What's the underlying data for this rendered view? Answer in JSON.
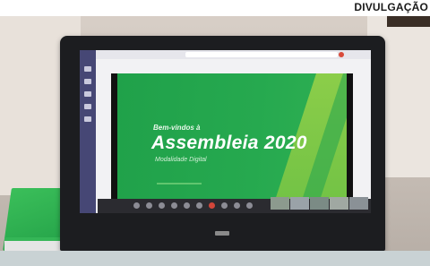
{
  "credit": "DIVULGAÇÃO",
  "slide": {
    "welcome": "Bem-vindos à",
    "headline": "Assembleia 2020",
    "subtitle": "Modalidade Digital"
  },
  "colors": {
    "slide_green": "#26a94f",
    "accent_lime": "#8fcf4a",
    "teams_rail": "#464775"
  },
  "icons": [
    "chat-icon",
    "teams-icon",
    "calendar-icon",
    "calls-icon",
    "files-icon",
    "camera-icon",
    "mic-icon",
    "share-icon",
    "hangup-icon"
  ]
}
